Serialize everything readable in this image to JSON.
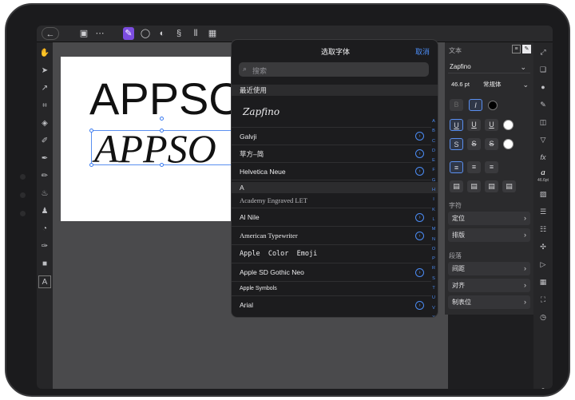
{
  "topbar": {
    "back": "←",
    "icons": [
      "document-icon",
      "more-icon",
      "designer-persona-icon",
      "pixel-persona-icon",
      "export-persona-icon",
      "snapping-icon",
      "align-icon",
      "grid-icon"
    ]
  },
  "canvas": {
    "text_line1": "APPSO",
    "text_line2": "APPSO"
  },
  "popover": {
    "title": "选取字体",
    "cancel": "取消",
    "search_placeholder": "搜索",
    "recent_header": "最近使用",
    "recent_sample": "Zapfino",
    "fonts_recent": [
      "Galvji",
      "苹方–简",
      "Helvetica Neue"
    ],
    "section_a": "A",
    "fonts_a": [
      "Academy Engraved LET",
      "Al Nile",
      "American Typewriter",
      "Apple  Color  Emoji",
      "Apple SD Gothic Neo",
      "Apple Symbols",
      "Arial"
    ],
    "index": [
      "A",
      "B",
      "C",
      "D",
      "E",
      "F",
      "G",
      "H",
      "I",
      "K",
      "L",
      "M",
      "N",
      "O",
      "P",
      "R",
      "S",
      "T",
      "U",
      "V",
      "X",
      "Y",
      "Z",
      "#"
    ]
  },
  "panel": {
    "title": "文本",
    "font_name": "Zapfino",
    "size": "46.6 pt",
    "style": "常规体",
    "row_char_header": "字符",
    "rows_char": [
      "定位",
      "排版"
    ],
    "row_para_header": "段落",
    "rows_para": [
      "间距",
      "对齐",
      "制表位"
    ],
    "size_badge": "46.6pt",
    "help": "?"
  }
}
